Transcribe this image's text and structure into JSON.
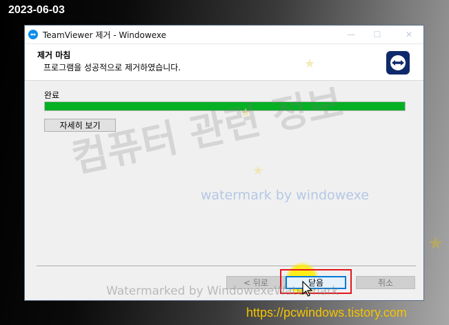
{
  "overlay": {
    "date": "2023-06-03",
    "site_url": "https://pcwindows.tistory.com"
  },
  "window": {
    "title": "TeamViewer 제거    - Windowexe",
    "controls": {
      "minimize": "—",
      "maximize": "☐",
      "close": "✕"
    }
  },
  "header": {
    "title": "제거 마침",
    "subtitle": "프로그램을 성공적으로 제거하였습니다."
  },
  "content": {
    "status_label": "완료",
    "progress": 1.0,
    "details_button": "자세히 보기"
  },
  "watermarks": {
    "korean": "컴퓨터 관련 정보",
    "blue": "watermark by windowexe",
    "bottom": "Watermarked by WindowexeWatermark"
  },
  "buttons": {
    "back": "< 뒤로",
    "close": "닫음",
    "cancel": "취소"
  },
  "colors": {
    "progress_fill": "#06b025",
    "highlight": "#e3141b",
    "accent": "#0078d7",
    "url": "#f5c400"
  }
}
